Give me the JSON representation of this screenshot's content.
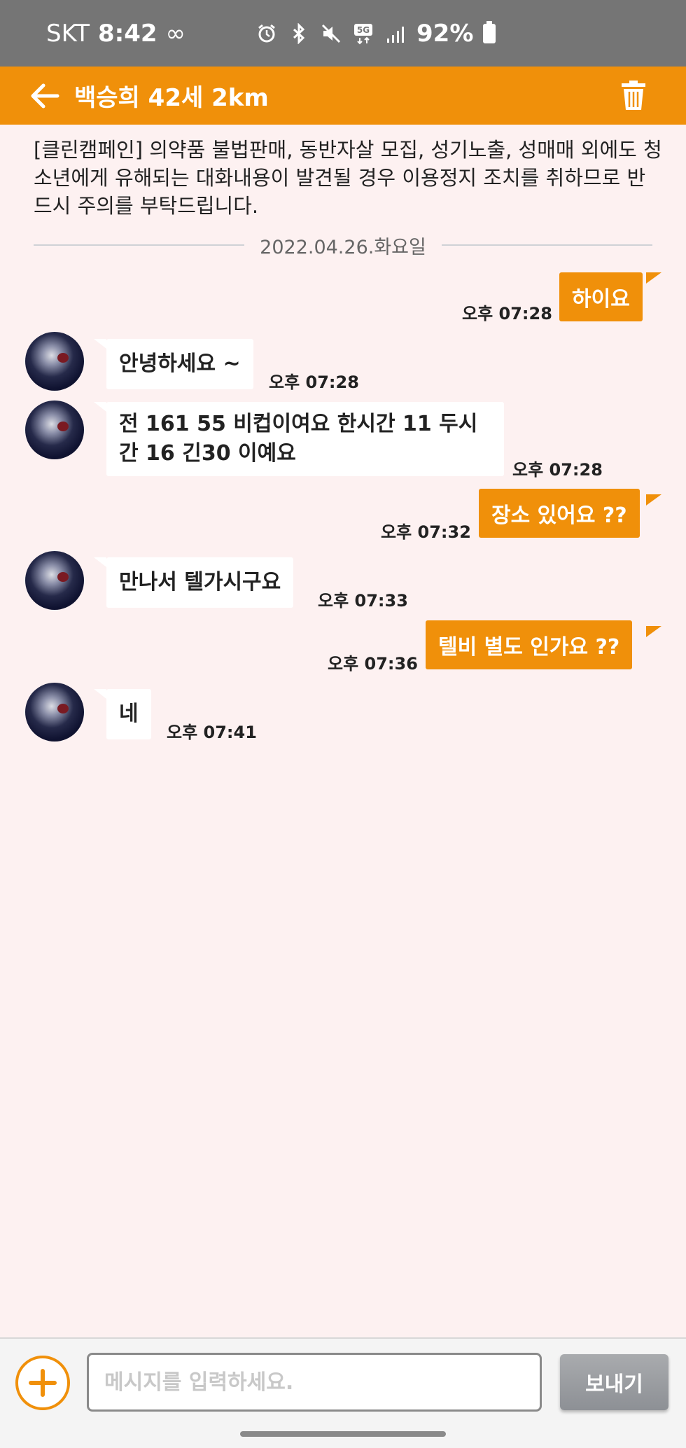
{
  "status_bar": {
    "carrier": "SKT",
    "time": "8:42",
    "infinity": "∞",
    "icons": [
      "alarm-icon",
      "bluetooth-icon",
      "mute-icon",
      "5g-icon",
      "signal-icon"
    ],
    "network": "5G",
    "battery_pct": "92%"
  },
  "header": {
    "title": "백승희 42세 2km",
    "accent_color": "#f0900a"
  },
  "notice": "[클린캠페인] 의약품 불법판매, 동반자살 모집, 성기노출, 성매매 외에도 청소년에게 유해되는 대화내용이 발견될 경우 이용정지 조치를 취하므로 반드시 주의를 부탁드립니다.",
  "date_divider": "2022.04.26.화요일",
  "messages": [
    {
      "direction": "out",
      "text": "하이요",
      "time": "오후 07:28"
    },
    {
      "direction": "in",
      "text": "안녕하세요 ~",
      "time": "오후 07:28"
    },
    {
      "direction": "in",
      "text": "전 161 55 비컵이여요 한시간 11 두시간 16 긴30 이예요",
      "time": "오후 07:28"
    },
    {
      "direction": "out",
      "text": "장소 있어요 ??",
      "time": "오후 07:32"
    },
    {
      "direction": "in",
      "text": "만나서 텔가시구요",
      "time": "오후 07:33"
    },
    {
      "direction": "out",
      "text": "텔비 별도 인가요 ??",
      "time": "오후 07:36"
    },
    {
      "direction": "in",
      "text": "네",
      "time": "오후 07:41"
    }
  ],
  "input_bar": {
    "placeholder": "메시지를 입력하세요.",
    "send_label": "보내기"
  }
}
